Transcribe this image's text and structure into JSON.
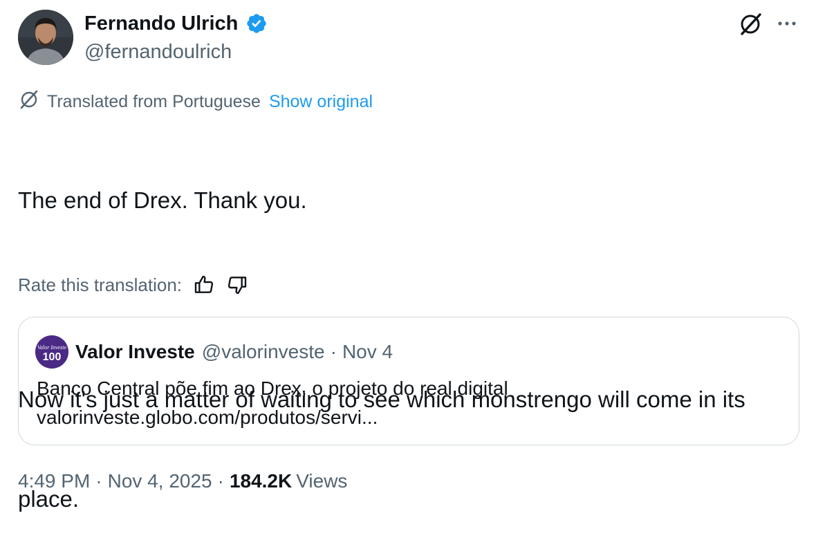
{
  "author": {
    "name": "Fernando Ulrich",
    "handle": "@fernandoulrich",
    "verified": true,
    "avatar_icon": "profile-photo"
  },
  "header_icons": [
    "grok-icon",
    "more-icon"
  ],
  "translation": {
    "label": "Translated from Portuguese",
    "show_original": "Show original",
    "icon": "grok-translate-icon"
  },
  "tweet": {
    "lines": [
      "The end of Drex. Thank you.",
      "",
      "Now it's just a matter of waiting to see which monstrengo will come in its",
      "place."
    ]
  },
  "rate": {
    "label": "Rate this translation:",
    "up_icon": "thumbs-up-icon",
    "down_icon": "thumbs-down-icon"
  },
  "quote": {
    "avatar_text": "100",
    "avatar_brand": "Valor Investe",
    "name": "Valor Investe",
    "handle": "@valorinveste",
    "separator": "·",
    "date": "Nov 4",
    "text": "Banco Central põe fim ao Drex, o projeto do real digital",
    "link": "valorinveste.globo.com/produtos/servi..."
  },
  "meta": {
    "time": "4:49 PM",
    "sep1": "·",
    "date": "Nov 4, 2025",
    "sep2": "·",
    "views_count": "184.2K",
    "views_label": "Views"
  },
  "colors": {
    "text": "#0f1419",
    "muted": "#536471",
    "link": "#1d9bf0",
    "verified": "#1d9bf0",
    "border": "#cfd9de"
  }
}
